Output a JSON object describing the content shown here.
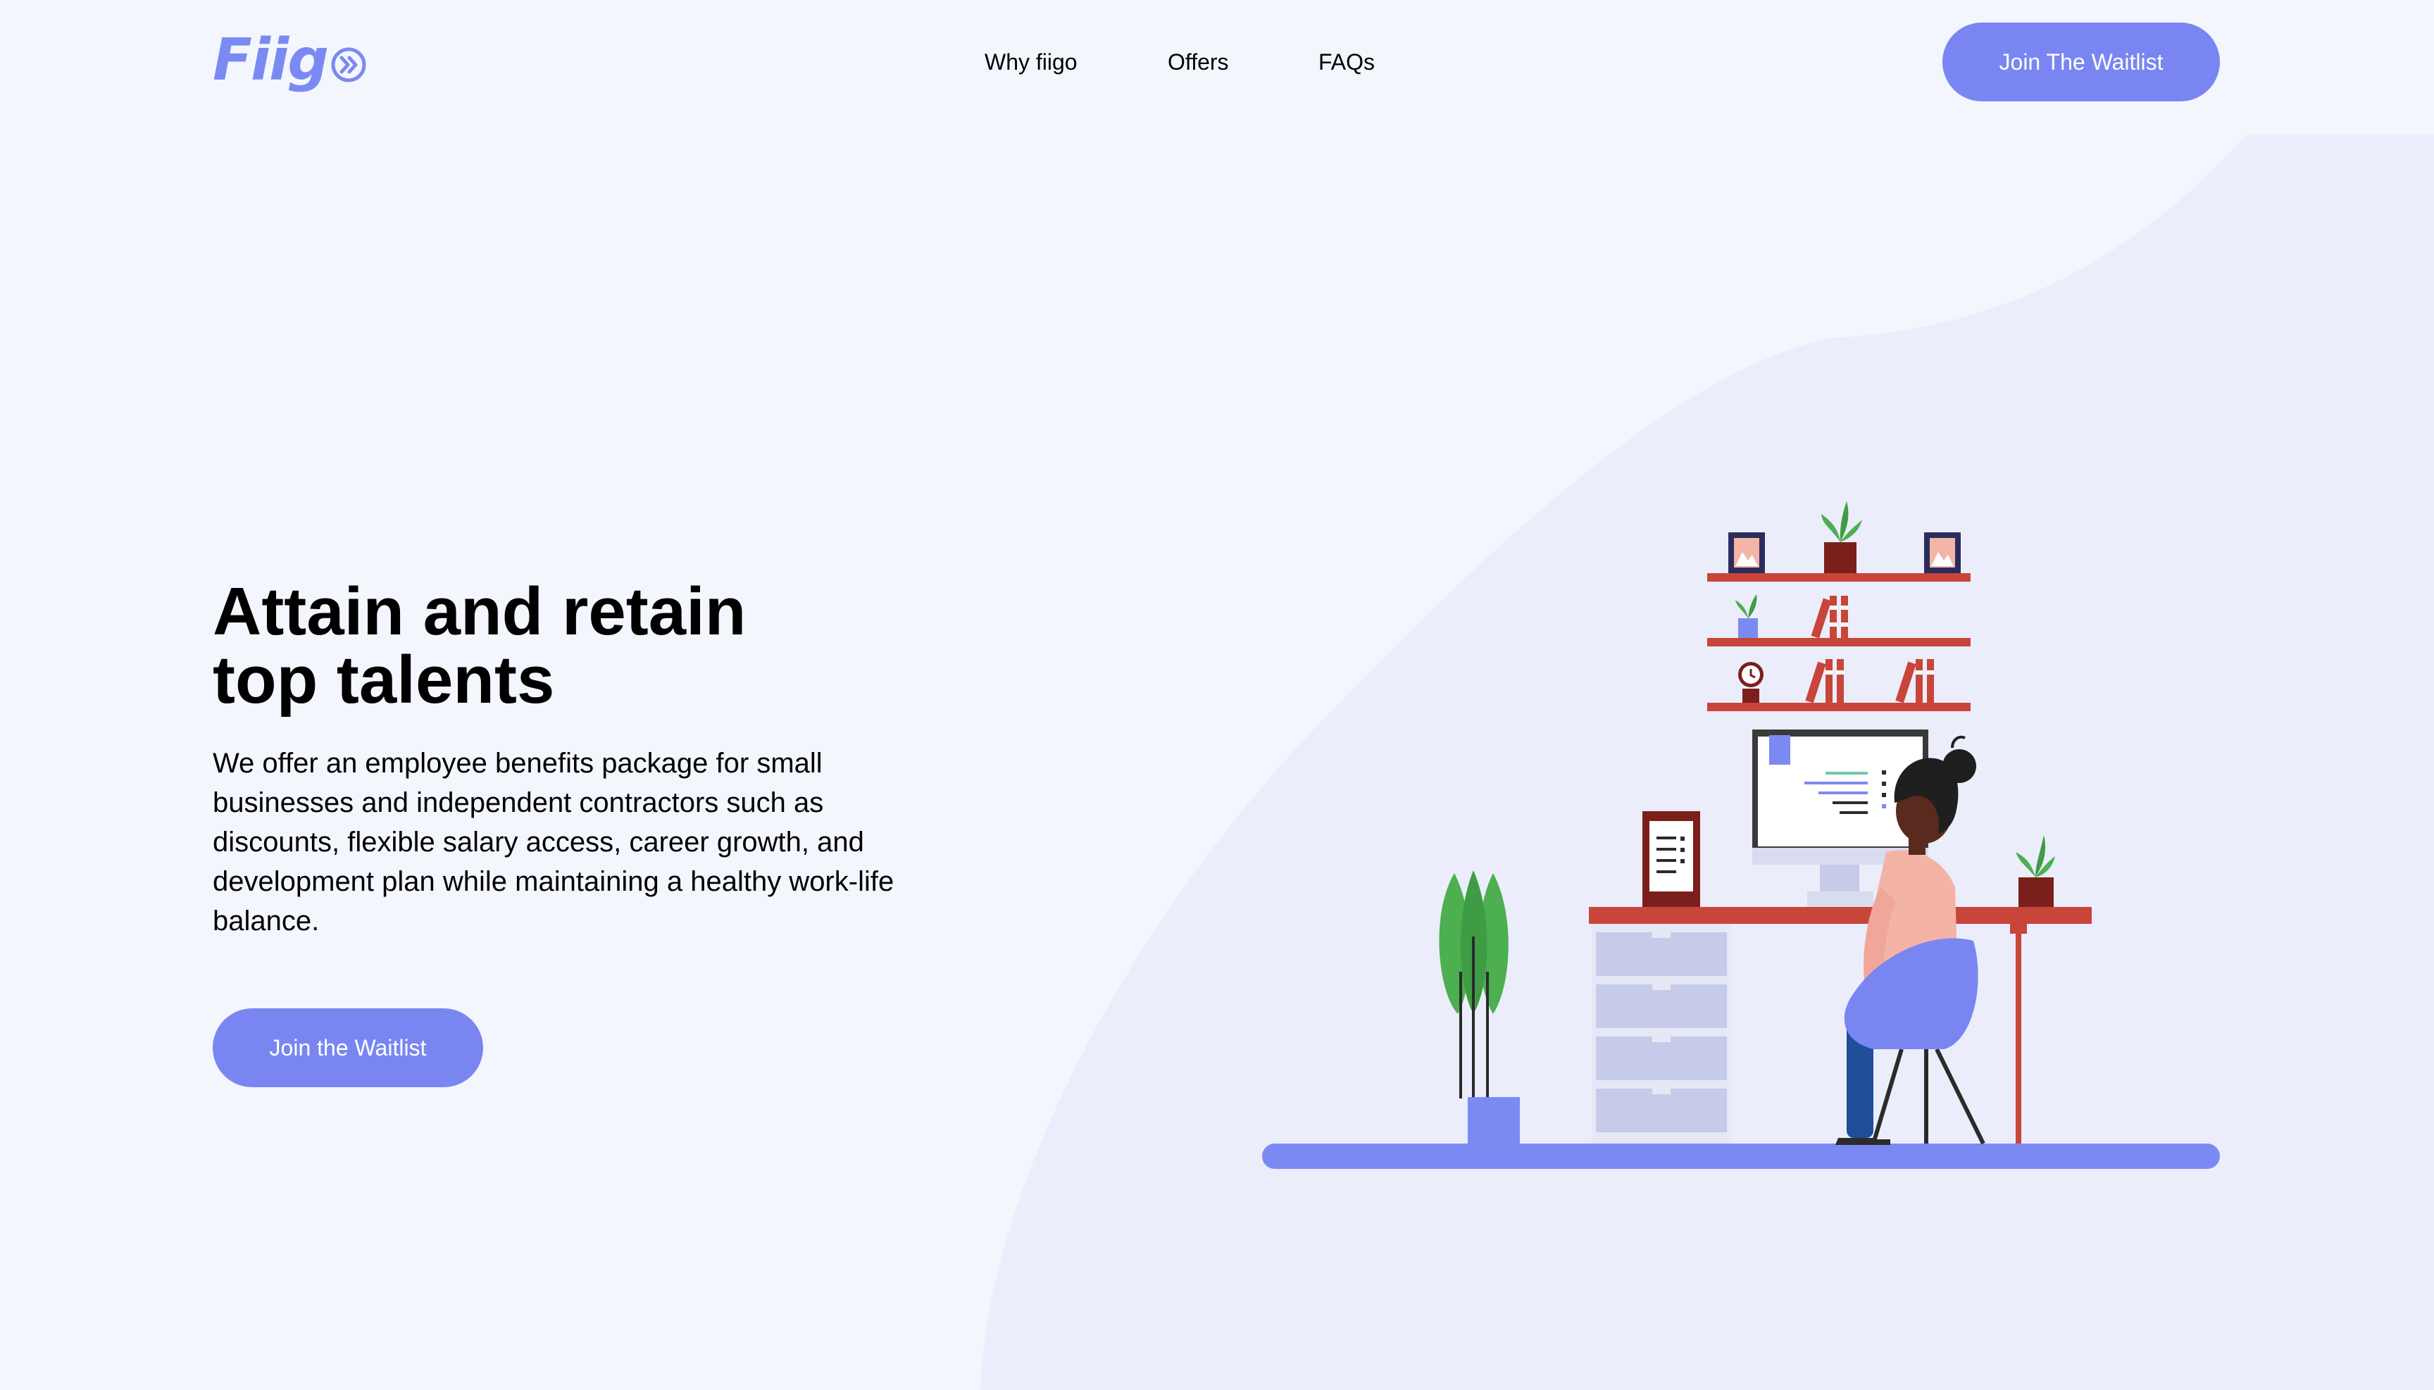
{
  "brand": {
    "name": "Fiig",
    "accent_color": "#7986f2",
    "logo_icon": "double-chevron-right-icon"
  },
  "nav": {
    "items": [
      {
        "label": "Why fiigo"
      },
      {
        "label": "Offers"
      },
      {
        "label": "FAQs"
      }
    ],
    "cta_label": "Join The Waitlist"
  },
  "hero": {
    "title_line1": "Attain and retain",
    "title_line2": "top talents",
    "description": "We offer an employee benefits package for small businesses and independent contractors such as discounts, flexible salary access, career growth, and development plan while maintaining a healthy work-life balance.",
    "cta_label": "Join the Waitlist"
  },
  "colors": {
    "page_background": "#f4f6fe",
    "blob_background": "#ecedfb",
    "button": "#7986f2",
    "shelf": "#c8453a"
  }
}
